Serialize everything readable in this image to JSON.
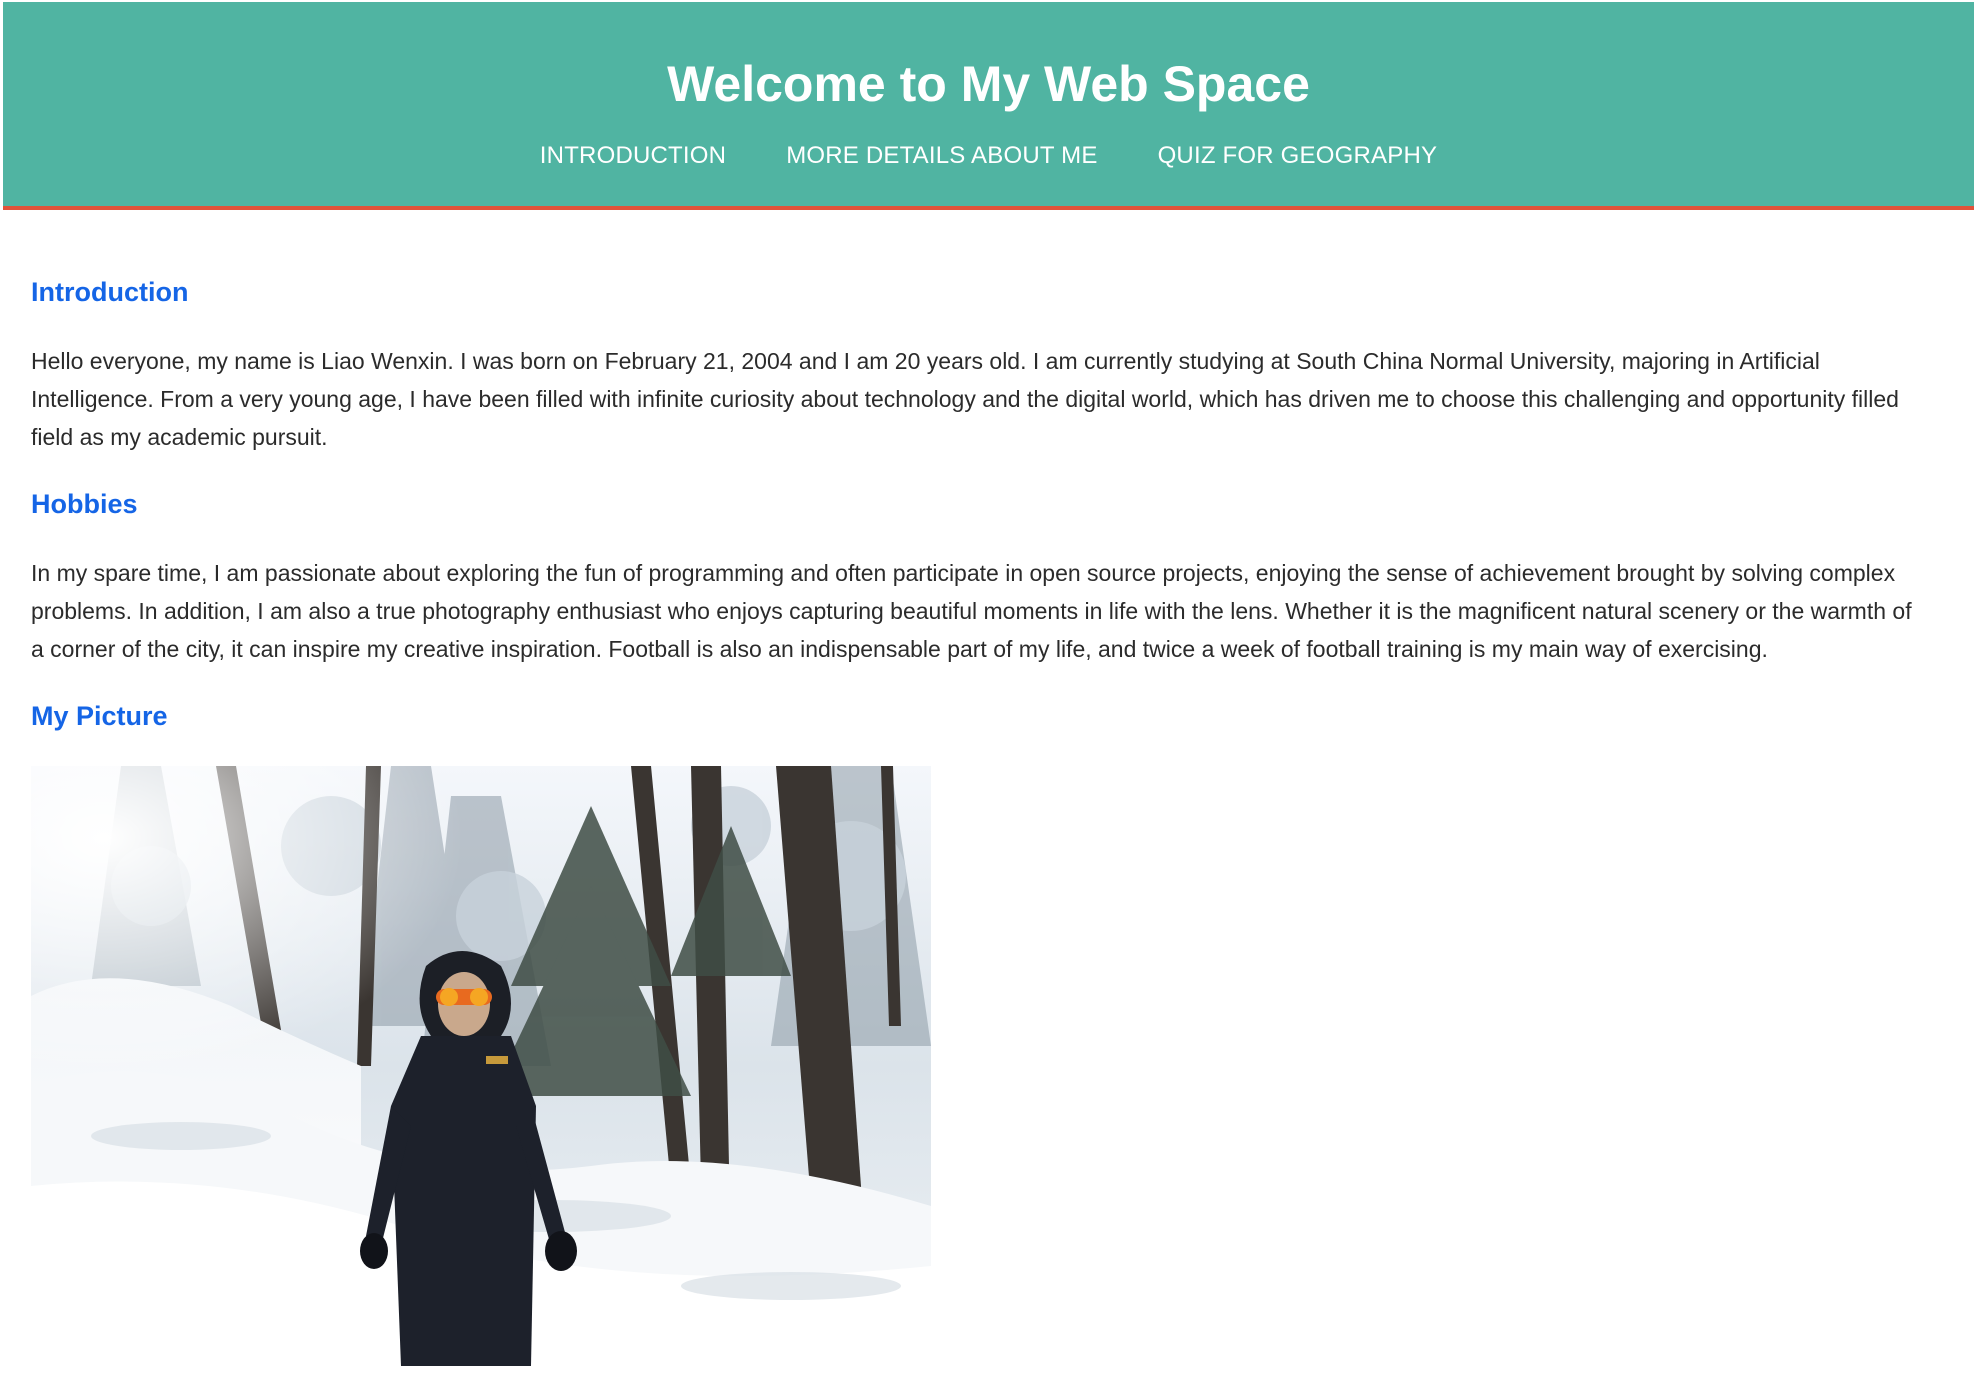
{
  "header": {
    "title": "Welcome to My Web Space",
    "nav": [
      {
        "label": "INTRODUCTION"
      },
      {
        "label": "MORE DETAILS ABOUT ME"
      },
      {
        "label": "QUIZ FOR GEOGRAPHY"
      }
    ]
  },
  "sections": {
    "introduction": {
      "heading": "Introduction",
      "text": "Hello everyone, my name is Liao Wenxin. I was born on February 21, 2004 and I am 20 years old. I am currently studying at South China Normal University, majoring in Artificial Intelligence. From a very young age, I have been filled with infinite curiosity about technology and the digital world, which has driven me to choose this challenging and opportunity filled field as my academic pursuit."
    },
    "hobbies": {
      "heading": "Hobbies",
      "text": "In my spare time, I am passionate about exploring the fun of programming and often participate in open source projects, enjoying the sense of achievement brought by solving complex problems. In addition, I am also a true photography enthusiast who enjoys capturing beautiful moments in life with the lens. Whether it is the magnificent natural scenery or the warmth of a corner of the city, it can inspire my creative inspiration. Football is also an indispensable part of my life, and twice a week of football training is my main way of exercising."
    },
    "picture": {
      "heading": "My Picture"
    }
  },
  "colors": {
    "header_bg": "#50b4a2",
    "header_border": "#e0533a",
    "heading": "#1565e6",
    "body_text": "#2b2b2b"
  }
}
